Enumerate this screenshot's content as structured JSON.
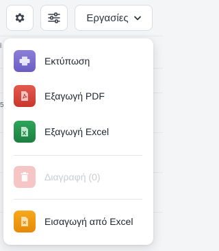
{
  "toolbar": {
    "gear_icon": "gear-icon",
    "filter_icon": "sliders-icon",
    "tasks_label": "Εργασίες",
    "tasks_icon": "chevron-down-icon"
  },
  "background": {
    "row_char_1": "l",
    "row_char_2": "5"
  },
  "menu": {
    "items": [
      {
        "label": "Εκτύπωση",
        "icon": "printer-icon",
        "color": "#7b6fd0",
        "enabled": true
      },
      {
        "label": "Εξαγωγή PDF",
        "icon": "pdf-file-icon",
        "color": "#d6463b",
        "enabled": true
      },
      {
        "label": "Εξαγωγή Excel",
        "icon": "excel-file-icon",
        "color": "#26924e",
        "enabled": true
      },
      {
        "label": "Διαγραφή (0)",
        "icon": "trash-icon",
        "color": "#f6c5c5",
        "enabled": false
      },
      {
        "label": "Εισαγωγή από Excel",
        "icon": "import-file-icon",
        "color": "#f09a10",
        "enabled": true
      }
    ]
  }
}
